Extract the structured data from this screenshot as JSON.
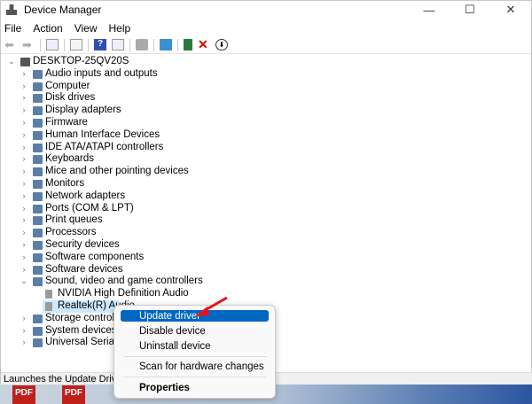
{
  "window": {
    "title": "Device Manager",
    "minimize": "—",
    "maximize": "☐",
    "close": "✕"
  },
  "menu": [
    "File",
    "Action",
    "View",
    "Help"
  ],
  "toolbar": [
    "back-icon",
    "forward-icon",
    "show-hide-console-tree-icon",
    "properties-icon",
    "help-icon",
    "action-pane-icon",
    "print-icon",
    "scan-hardware-icon",
    "update-driver-icon",
    "uninstall-icon",
    "disable-icon"
  ],
  "tree": {
    "root": "DESKTOP-25QV20S",
    "categories": [
      "Audio inputs and outputs",
      "Computer",
      "Disk drives",
      "Display adapters",
      "Firmware",
      "Human Interface Devices",
      "IDE ATA/ATAPI controllers",
      "Keyboards",
      "Mice and other pointing devices",
      "Monitors",
      "Network adapters",
      "Ports (COM & LPT)",
      "Print queues",
      "Processors",
      "Security devices",
      "Software components",
      "Software devices",
      "Sound, video and game controllers"
    ],
    "sound_children": [
      "NVIDIA High Definition Audio",
      "Realtek(R) Audio"
    ],
    "after": [
      "Storage controllers",
      "System devices",
      "Universal Serial Bus controllers"
    ]
  },
  "context_menu": {
    "update": "Update driver",
    "disable": "Disable device",
    "uninstall": "Uninstall device",
    "scan": "Scan for hardware changes",
    "properties": "Properties"
  },
  "status": "Launches the Update Driver Wizard for the selected device.",
  "desktop": {
    "pdf1": "PDF",
    "pdf2": "PDF"
  }
}
